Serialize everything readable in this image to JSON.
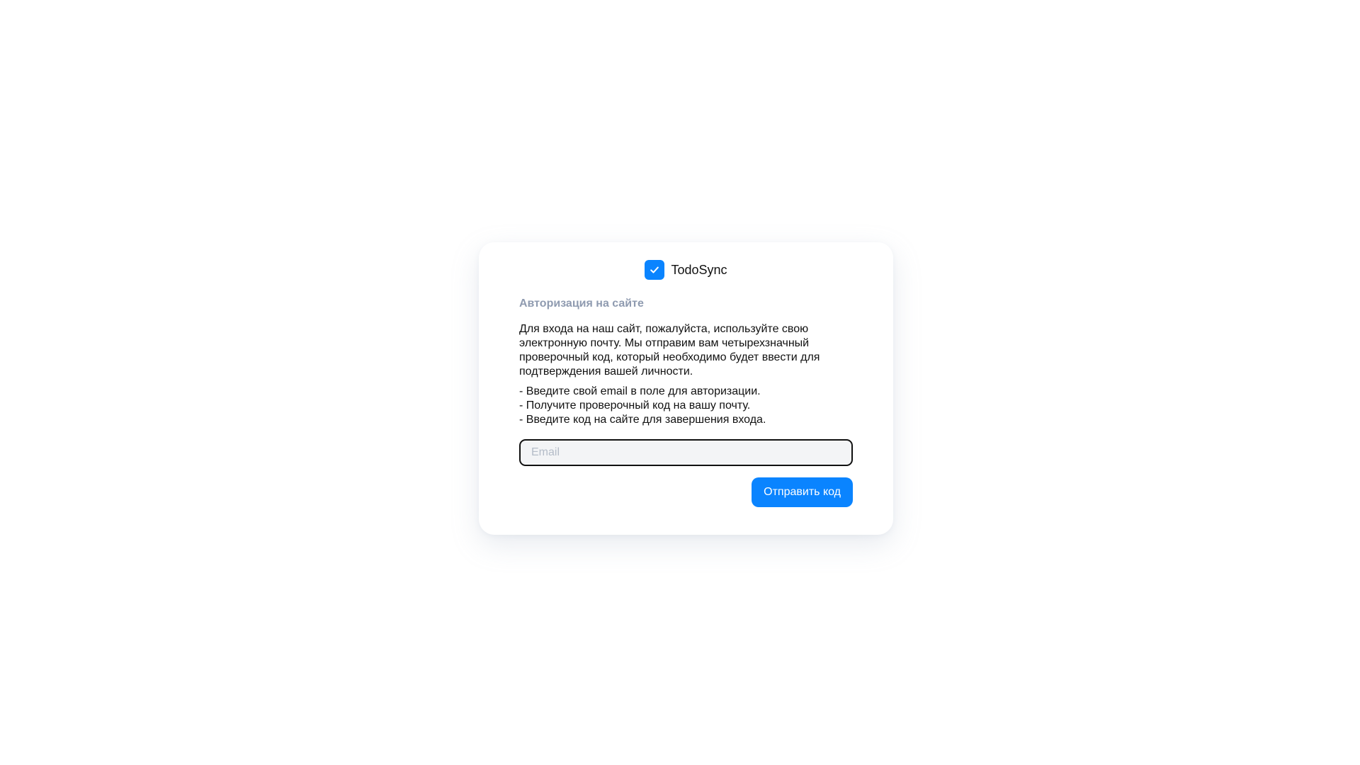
{
  "brand": {
    "name": "TodoSync",
    "icon": "check-icon",
    "color": "#0a84ff"
  },
  "auth": {
    "heading": "Авторизация на сайте",
    "description": "Для входа на наш сайт, пожалуйста, используйте свою электронную почту. Мы отправим вам четырехзначный проверочный код, который необходимо будет ввести для подтверждения вашей личности.",
    "steps": [
      "- Введите свой email в поле для авторизации.",
      "- Получите проверочный код на вашу почту.",
      "- Введите код на сайте для завершения входа."
    ],
    "email": {
      "placeholder": "Email",
      "value": ""
    },
    "submit_label": "Отправить код"
  },
  "colors": {
    "accent": "#0a84ff",
    "heading": "#8f9bb0",
    "input_background": "#f3f4f6"
  }
}
